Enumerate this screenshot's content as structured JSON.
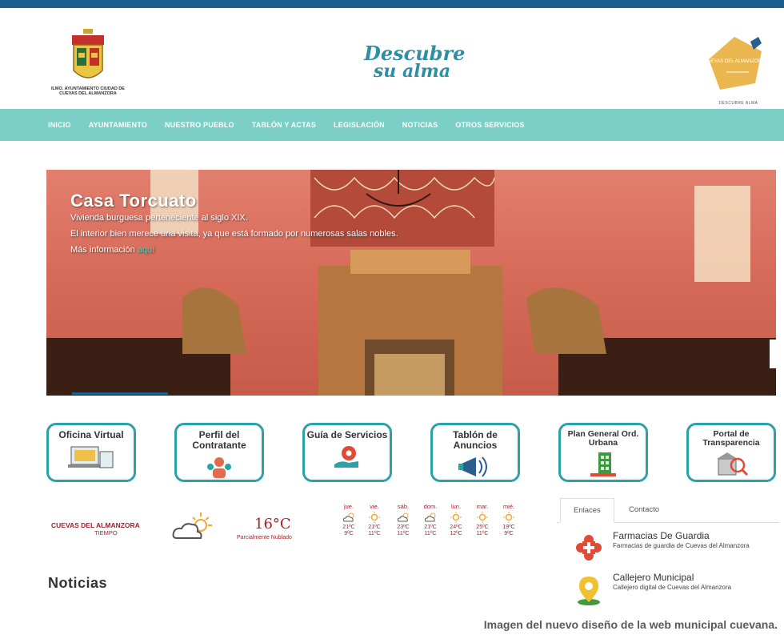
{
  "header": {
    "crest_text": "ILMO. AYUNTAMIENTO CIUDAD DE CUEVAS DEL ALMANZORA",
    "tagline_line1": "Descubre",
    "tagline_line2": "su alma",
    "badge_text": "CUEVAS DEL ALMANZORA",
    "badge_subtext": "DESCUBRE ALMA"
  },
  "nav": {
    "items": [
      "INICIO",
      "AYUNTAMIENTO",
      "NUESTRO PUEBLO",
      "TABLÓN Y ACTAS",
      "LEGISLACIÓN",
      "NOTICIAS",
      "OTROS SERVICIOS"
    ]
  },
  "hero": {
    "title": "Casa Torcuato",
    "line1": "Vivienda burguesa perteneciente al siglo XIX.",
    "line2": "El interior bien merece una visita, ya que está formado por numerosas salas nobles.",
    "more_text": "Más información",
    "more_link": "aquí"
  },
  "services": {
    "items": [
      {
        "label": "Oficina Virtual"
      },
      {
        "label": "Perfil del Contratante"
      },
      {
        "label": "Guía de Servicios"
      },
      {
        "label": "Tablón de Anuncios"
      },
      {
        "label": "Plan General Ord. Urbana"
      },
      {
        "label": "Portal de Transparencia"
      }
    ]
  },
  "weather": {
    "city": "CUEVAS DEL ALMANZORA",
    "label": "TIEMPO",
    "temp": "16°C",
    "desc": "Parcialmente Nublado",
    "forecast": [
      {
        "day": "jue.",
        "max": "21ºC",
        "min": "9ºC",
        "icon": "cloud-sun-icon"
      },
      {
        "day": "vie.",
        "max": "21ºC",
        "min": "11ºC",
        "icon": "sun-icon"
      },
      {
        "day": "sáb.",
        "max": "23ºC",
        "min": "11ºC",
        "icon": "cloud-sun-icon"
      },
      {
        "day": "dom.",
        "max": "21ºC",
        "min": "11ºC",
        "icon": "cloud-sun-icon"
      },
      {
        "day": "lun.",
        "max": "24ºC",
        "min": "12ºC",
        "icon": "sun-icon"
      },
      {
        "day": "mar.",
        "max": "25ºC",
        "min": "11ºC",
        "icon": "sun-icon"
      },
      {
        "day": "mié.",
        "max": "19ºC",
        "min": "9ºC",
        "icon": "sun-icon"
      }
    ]
  },
  "panel": {
    "tabs": [
      "Enlaces",
      "Contacto"
    ],
    "links": [
      {
        "title": "Farmacias De Guardia",
        "desc": "Farmacias de guardia de Cuevas del Almanzora"
      },
      {
        "title": "Callejero Municipal",
        "desc": "Callejero digital de Cuevas del Almanzora"
      }
    ]
  },
  "news": {
    "title": "Noticias"
  },
  "caption": "Imagen del nuevo diseño de la web municipal cuevana.",
  "colors": {
    "topbar": "#1b5d8c",
    "nav": "#7ccfc7",
    "accent": "#29a3a6",
    "weather": "#a3222b"
  }
}
